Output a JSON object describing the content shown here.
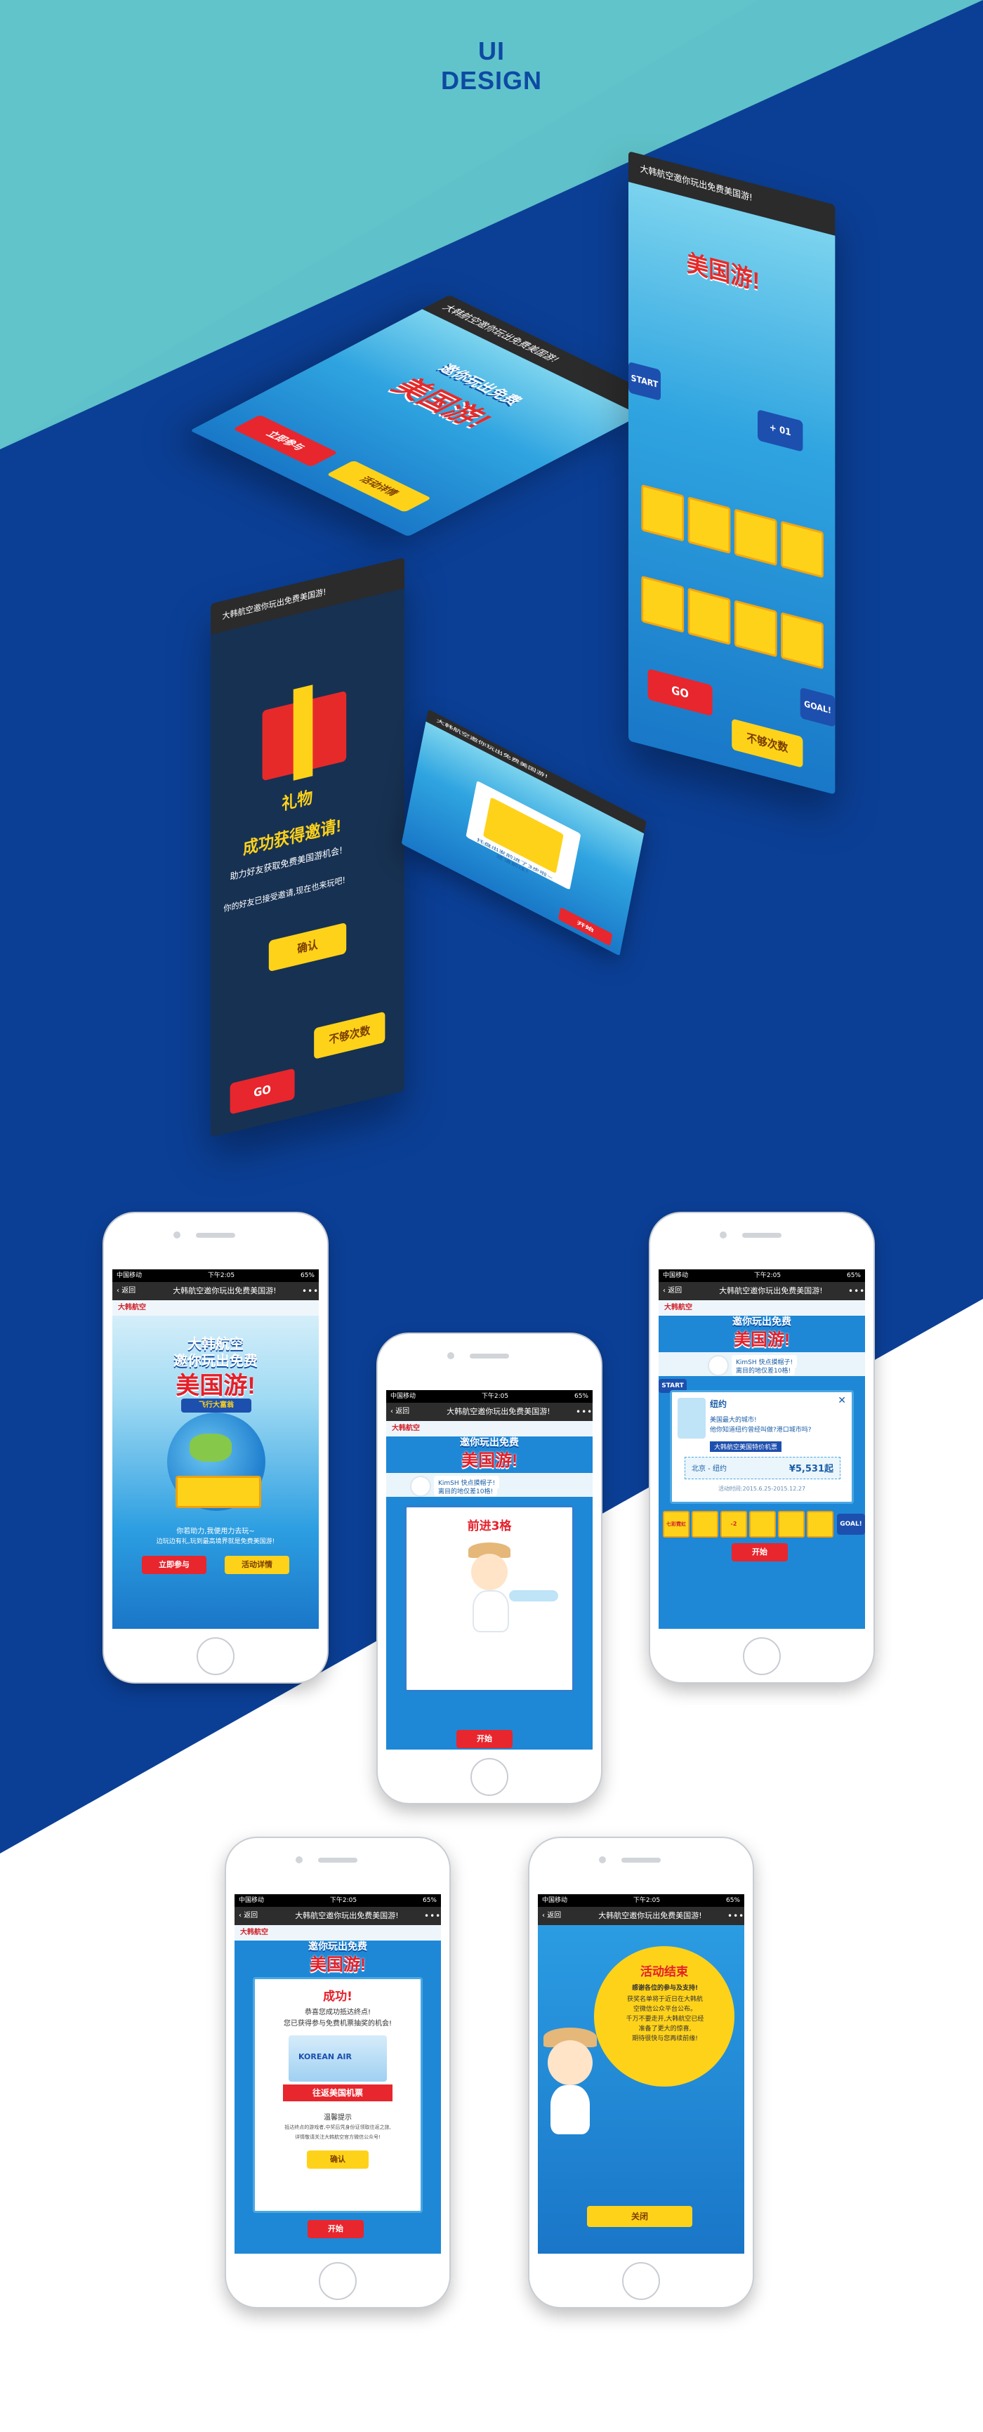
{
  "header": {
    "line1": "UI",
    "line2": "DESIGN"
  },
  "app": {
    "page_title": "大韩航空邀你玩出免费美国游!",
    "back_label": "返回",
    "more_label": "•••",
    "brand": "大韩航空",
    "carrier_label": "中国移动",
    "time": "下午2:05",
    "battery": "65%"
  },
  "game": {
    "title_line1": "大韩航空",
    "title_line2": "邀你玩出免费",
    "title_big": "美国游!",
    "ribbon": "飞行大富翁",
    "start_label": "START",
    "goal_label": "GOAL!",
    "go_label": "GO",
    "roll_label": "开始",
    "not_enough_label": "不够次数",
    "plus_one": "+ 01",
    "minus_two": "-2",
    "tile_label": "七彩霓虹"
  },
  "home": {
    "intro_line1": "你若助力,我便用力去玩~",
    "intro_line2": "边玩边有礼,玩到最高境界就是免费美国游!",
    "join_label": "立即参与",
    "rules_label": "活动详情"
  },
  "friend": {
    "name_line": "KimSH 快点摸帽子!",
    "desc_line": "离目的地仅差10格!"
  },
  "advance": {
    "title": "前进3格"
  },
  "city": {
    "name": "纽约",
    "question1": "美国最大的城市!",
    "question2": "他你知道纽约曾经叫做?港口城市吗?",
    "tag": "大韩航空美国特价机票",
    "route": "北京 - 纽约",
    "price": "¥5,531起",
    "period": "活动时间:2015.6.25-2015.12.27",
    "close": "✕"
  },
  "gift": {
    "title": "礼物",
    "headline": "成功获得邀请!",
    "line1": "助力好友获取免费美国游机会!",
    "line2": "你的好友已接受邀请,现在也来玩吧!",
    "confirm": "确认",
    "restart": "不够次数"
  },
  "success": {
    "title": "成功!",
    "line1": "恭喜您成功抵达终点!",
    "line2": "您已获得参与免费机票抽奖的机会!",
    "ticket_brand": "KOREAN AIR",
    "ribbon": "往返美国机票",
    "hint_title": "温馨提示",
    "hint1": "抵达终点的游戏者,中奖后凭身份证领取往返之旅,",
    "hint2": "详情敬请关注大韩航空官方微信公众号!",
    "confirm": "确认"
  },
  "ended": {
    "title": "活动结束",
    "line1": "感谢各位的参与及支持!",
    "line2": "获奖名单将于近日在大韩航",
    "line3": "空微信公众平台公布。",
    "line4": "千万不要走开,大韩航空已经",
    "line5": "准备了更大的惊喜,",
    "line6": "期待很快与您再续前缘!",
    "close": "关闭"
  },
  "popup_text": {
    "hop": "托盘出发前进了3步啦~",
    "hop2": "还请前往!"
  },
  "colors": {
    "teal": "#5fc1c9",
    "navy": "#0b3f96",
    "brand_red": "#e8262d",
    "brand_yellow": "#ffd21a",
    "sky": "#1e88d6"
  }
}
